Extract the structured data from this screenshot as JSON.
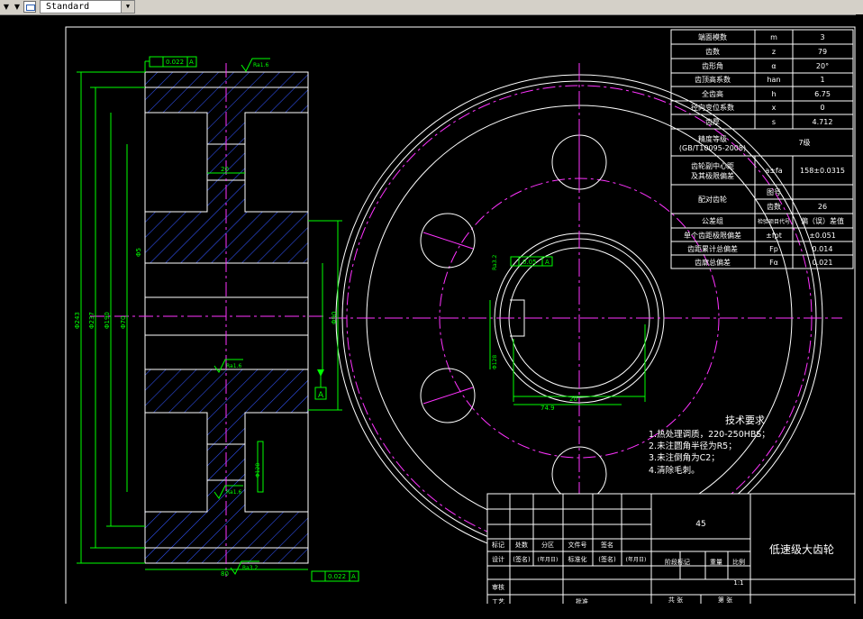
{
  "toolbar": {
    "text_style_value": "Standard"
  },
  "drawing": {
    "title": "低速级大齿轮",
    "material": "45",
    "scale": "1:1",
    "sheet_total": "共  张",
    "sheet_no": "第  张",
    "title_block": {
      "stage_mark": "阶段标记",
      "weight": "重量",
      "scale_label": "比例",
      "row_mark": [
        "标记",
        "处数",
        "分区",
        "文件号",
        "签名"
      ],
      "row_design": [
        "设计",
        "(签名)",
        "(年月日)",
        "标准化",
        "(签名)",
        "(年月日)"
      ],
      "review": "审核",
      "process": "工艺",
      "approve": "批准"
    },
    "parameters": [
      {
        "name": "端面模数",
        "sym": "m",
        "val": "3"
      },
      {
        "name": "齿数",
        "sym": "z",
        "val": "79"
      },
      {
        "name": "齿形角",
        "sym": "α",
        "val": "20°"
      },
      {
        "name": "齿顶高系数",
        "sym": "han",
        "val": "1"
      },
      {
        "name": "全齿高",
        "sym": "h",
        "val": "6.75"
      },
      {
        "name": "径向变位系数",
        "sym": "x",
        "val": "0"
      },
      {
        "name": "齿厚",
        "sym": "s",
        "val": "4.712"
      }
    ],
    "precision": {
      "name": "精度等级",
      "std": "(GB/T10095-2008)",
      "val": "7级"
    },
    "center_distance": {
      "name1": "齿轮副中心距",
      "name2": "及其极限偏差",
      "sym": "a±fa",
      "val": "158±0.0315"
    },
    "mating_gear": {
      "name": "配对齿轮",
      "drawing_no": "图号",
      "teeth": "齿数",
      "teeth_val": "26"
    },
    "tolerance_group": {
      "name": "公差组",
      "sym": "检验项目代号",
      "val": "偏（误）差值"
    },
    "deviations": [
      {
        "name": "单个齿距极限偏差",
        "sym": "±fpt",
        "val": "±0.051"
      },
      {
        "name": "齿距累计总偏差",
        "sym": "Fp",
        "val": "0.014"
      },
      {
        "name": "齿廓总偏差",
        "sym": "Fα",
        "val": "0.021"
      }
    ],
    "tech_requirements": {
      "title": "技术要求",
      "items": [
        "1.热处理调质，220-250HBS；",
        "2.未注圆角半径为R5；",
        "3.未注倒角为C2；",
        "4.清除毛刺。"
      ]
    },
    "annotations": {
      "runout_top": "0.022",
      "datum_a": "A",
      "ra16_a": "Ra1.6",
      "ra16_b": "Ra1.6",
      "ra16_c": "Ra1.6",
      "ra32": "Ra3.2",
      "width_80": "80",
      "runout_bottom": "0.022",
      "dim_20": "20",
      "keyway_sym": "0.05",
      "dia_label_1": "Φ243",
      "dia_label_2": "Φ237",
      "dia_label_3": "Φ190",
      "dia_label_4": "Φ70",
      "dia_label_5": "Φ5",
      "bore_dim": "Φ90",
      "keyway_w": "20",
      "keyway_depth": "74.9",
      "hub_dim": "Φ128",
      "key_h": "6",
      "web_ra": "Ra3.2"
    }
  }
}
